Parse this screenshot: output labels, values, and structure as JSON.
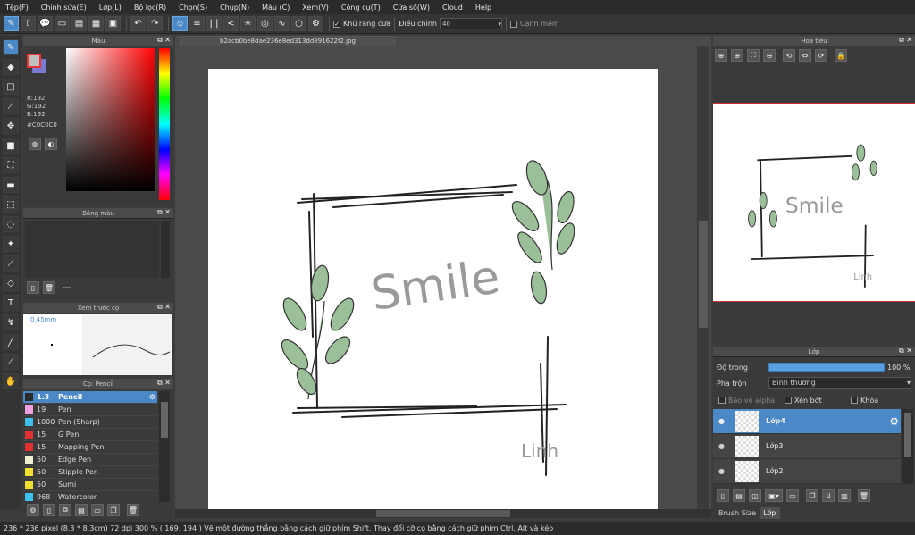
{
  "menu": [
    "Tệp(F)",
    "Chỉnh sửa(E)",
    "Lớp(L)",
    "Bộ lọc(R)",
    "Chọn(S)",
    "Chụp(N)",
    "Màu (C)",
    "Xem(V)",
    "Công cụ(T)",
    "Cửa sổ(W)",
    "Cloud",
    "Help"
  ],
  "toolbar": {
    "antialias_label": "Khử răng cưa",
    "adjust_label": "Điều chỉnh",
    "adjust_value": "40",
    "soft_edge_label": "Cạnh mềm"
  },
  "color_panel": {
    "title": "Màu",
    "r": "R:192",
    "g": "G:192",
    "b": "B:192",
    "hex": "#C0C0C0",
    "fg_color": "#c0c0c0",
    "bg_color": "#7a7ad0"
  },
  "palette_panel": {
    "title": "Bảng màu",
    "value": "---"
  },
  "preview_panel": {
    "title": "Xem trước cọ",
    "size": "0.45mm"
  },
  "brush_panel": {
    "title": "Cọ: Pencil",
    "brushes": [
      {
        "size": "1.3",
        "name": "Pencil",
        "color": "#2a2a2a"
      },
      {
        "size": "19",
        "name": "Pen",
        "color": "#f0a0e0"
      },
      {
        "size": "1000",
        "name": "Pen (Sharp)",
        "color": "#40c0f0"
      },
      {
        "size": "15",
        "name": "G Pen",
        "color": "#e03030"
      },
      {
        "size": "15",
        "name": "Mapping Pen",
        "color": "#e03030"
      },
      {
        "size": "50",
        "name": "Edge Pen",
        "color": "#f0f0d0"
      },
      {
        "size": "50",
        "name": "Stipple Pen",
        "color": "#f0e030"
      },
      {
        "size": "50",
        "name": "Sumi",
        "color": "#f0e030"
      },
      {
        "size": "968",
        "name": "Watercolor",
        "color": "#40c0f0"
      }
    ]
  },
  "document": {
    "tab": "b2acb0be8dae236e8ed313dd891622f2.jpg",
    "smile": "Smile",
    "sig": "Linh"
  },
  "navigator": {
    "title": "Hoa tiêu"
  },
  "layer_panel": {
    "title": "Lớp",
    "opacity_label": "Độ trong",
    "opacity_value": "100 %",
    "blend_label": "Pha trộn",
    "blend_value": "Bình thường",
    "protect_alpha": "Bảo vệ alpha",
    "clipping": "Xén bớt",
    "lock": "Khóa",
    "layers": [
      {
        "name": "Lớp4"
      },
      {
        "name": "Lớp3"
      },
      {
        "name": "Lớp2"
      }
    ],
    "tab_brush": "Brush Size",
    "tab_layer": "Lớp"
  },
  "status": "236 * 236 pixel  (8.3 * 8.3cm)  72 dpi  300 %  ( 169, 194 )  Vẽ một đường thẳng bằng cách giữ phím Shift, Thay đổi cỡ cọ bằng cách giữ phím Ctrl, Alt và kéo"
}
